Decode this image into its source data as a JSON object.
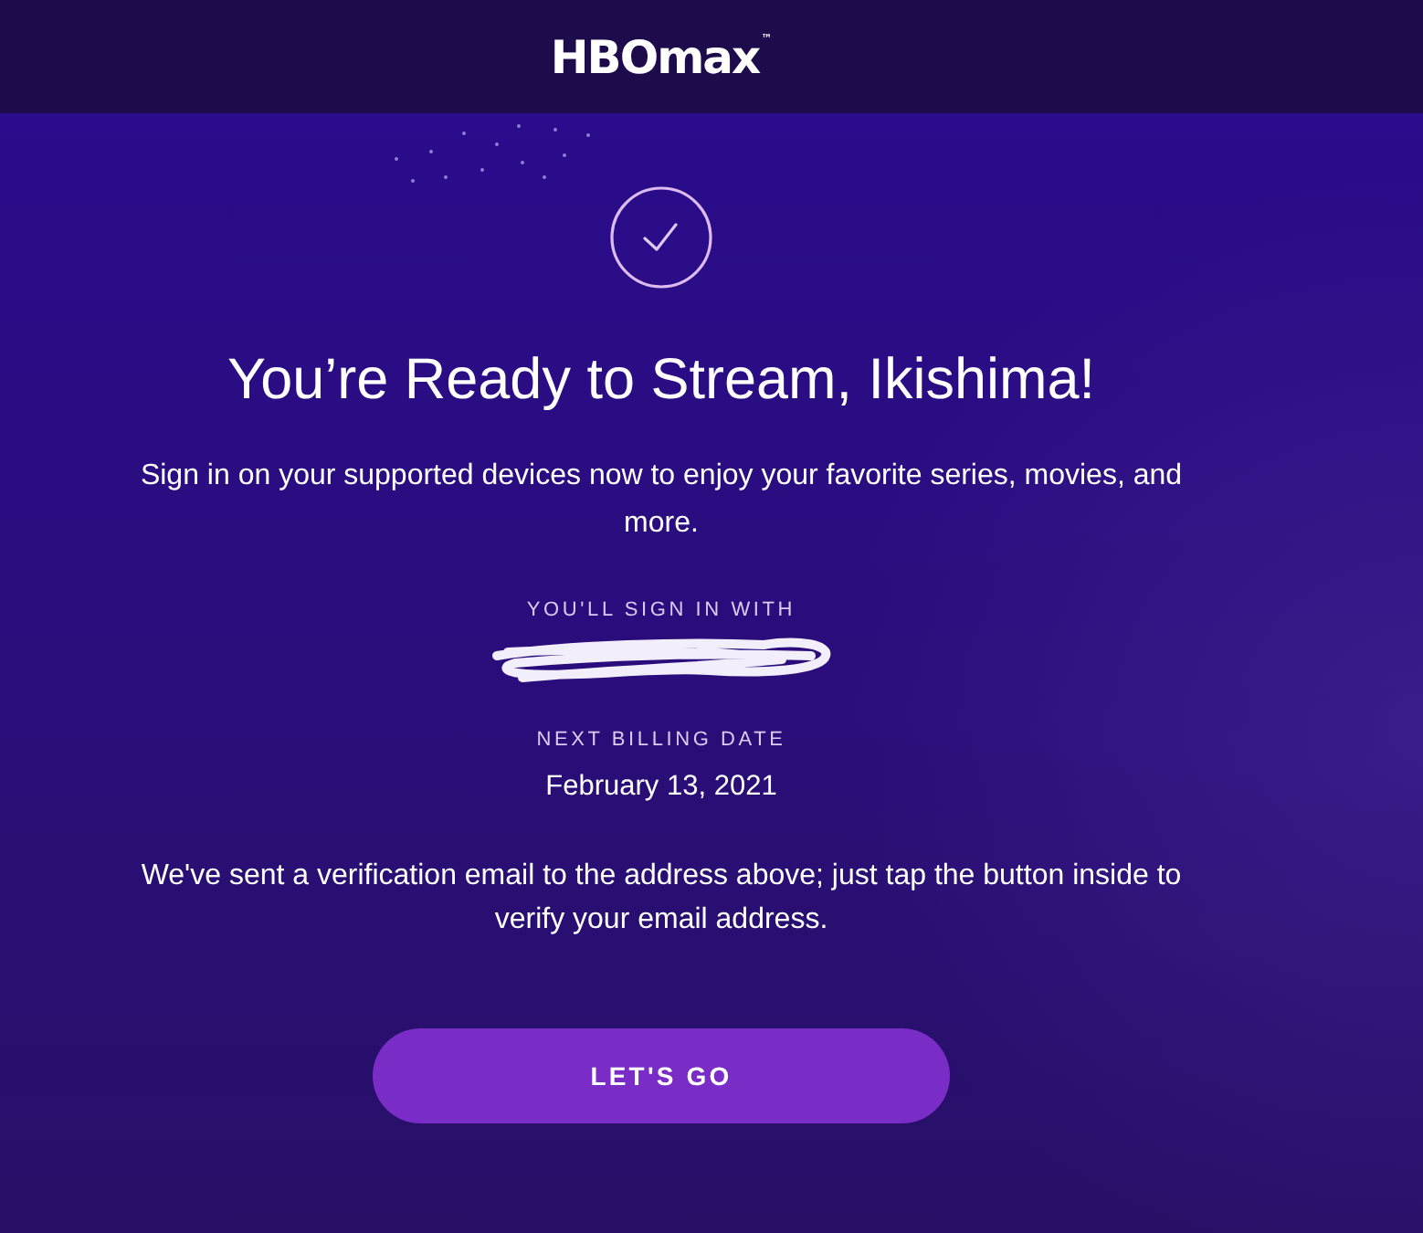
{
  "header": {
    "logo": "HBOmax$^{™}$"
  },
  "confirmation": {
    "title": "You’re Ready to Stream, Ikishima!",
    "message": "Sign in on your supported devices now to enjoy your favorite series, movies, and more.",
    "details": [
      {
        "kind": "redacted",
        "label": "YOU'LL SIGN IN WITH"
      },
      {
        "kind": "text",
        "label": "NEXT BILLING DATE",
        "value": "February 13, 2021"
      }
    ],
    "note": "We've sent a verification email to the address above; just tap the button inside to verify your email address.",
    "button": "LET'S GO"
  }
}
